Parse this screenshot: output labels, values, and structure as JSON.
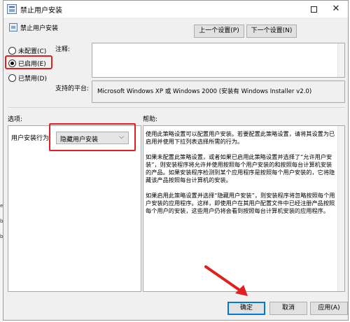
{
  "window": {
    "title": "禁止用户安装",
    "controls": {
      "maximize": "maximize",
      "close": "✕"
    }
  },
  "policy": {
    "name": "禁止用户安装",
    "prev_label": "上一个设置(P)",
    "next_label": "下一个设置(N)"
  },
  "state": {
    "options": [
      {
        "label": "未配置(C)",
        "checked": false
      },
      {
        "label": "已启用(E)",
        "checked": true
      },
      {
        "label": "已禁用(D)",
        "checked": false
      }
    ]
  },
  "comment": {
    "label": "注释:",
    "value": ""
  },
  "platform": {
    "label": "支持的平台:",
    "value": "Microsoft Windows XP 或 Windows 2000 (安装有 Windows Installer v2.0)"
  },
  "options_section": {
    "heading": "选项:",
    "field_label": "用户安装行为",
    "selected": "隐藏用户安装"
  },
  "help_section": {
    "heading": "帮助:",
    "paragraphs": [
      "使用此策略设置可以配置用户安装。若要配置此策略设置，请将其设置为已启用并使用下拉列表选择所需的行为。",
      "如果未配置此策略设置，或者如果已启用此策略设置并选择了“允许用户安装”，则安装程序将允许并使用按照每个用户安装的和按照每台计算机安装的产品。如果安装程序检测到某个应用程序是按照每个用户安装的，它将隐藏该产品按照每台计算机的安装。",
      "如果启用此策略设置并选择“隐藏用户安装”，则安装程序将忽略按照每个用户安装的应用程序。这样，即使用户在其用户配置文件中已经注册产品按照每个用户的安装，这些用户仍将会看到按照每台计算机安装的应用程序。"
    ]
  },
  "buttons": {
    "ok": "确定",
    "cancel": "取消",
    "apply": "应用(A)"
  },
  "annotation_color": "#e02020"
}
